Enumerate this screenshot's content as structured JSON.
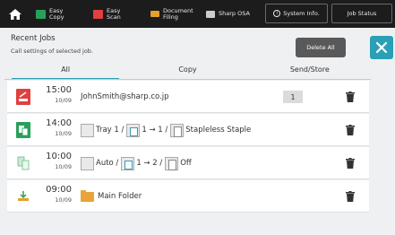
{
  "topbar": {
    "items": [
      {
        "line1": "Easy",
        "line2": "Copy",
        "color": "#27a05a"
      },
      {
        "line1": "Easy",
        "line2": "Scan",
        "color": "#e04040"
      },
      {
        "line1": "Document",
        "line2": "Filing",
        "color": "#e6a02a"
      },
      {
        "line1": "Sharp OSA",
        "line2": "",
        "color": "#cccccc"
      }
    ],
    "system_info": "System Info.",
    "job_status": "Job Status"
  },
  "header": {
    "title": "Recent Jobs",
    "subtitle": "Call settings of selected job.",
    "delete_all": "Delete All"
  },
  "tabs": [
    {
      "label": "All",
      "active": true
    },
    {
      "label": "Copy",
      "active": false
    },
    {
      "label": "Send/Store",
      "active": false
    }
  ],
  "jobs": [
    {
      "icon": "email-scan-icon",
      "time": "15:00",
      "date": "10/09",
      "text": "JohnSmith@sharp.co.jp",
      "copies": "1"
    },
    {
      "icon": "copy-icon",
      "time": "14:00",
      "date": "10/09",
      "tray": "Tray 1 /",
      "duplex": "1 → 1 /",
      "finish": "Stapleless Staple"
    },
    {
      "icon": "copy-light-icon",
      "time": "10:00",
      "date": "10/09",
      "tray": "Auto /",
      "duplex": "1 → 2 /",
      "finish": "Off"
    },
    {
      "icon": "store-icon",
      "time": "09:00",
      "date": "10/09",
      "text": "Main Folder"
    }
  ]
}
